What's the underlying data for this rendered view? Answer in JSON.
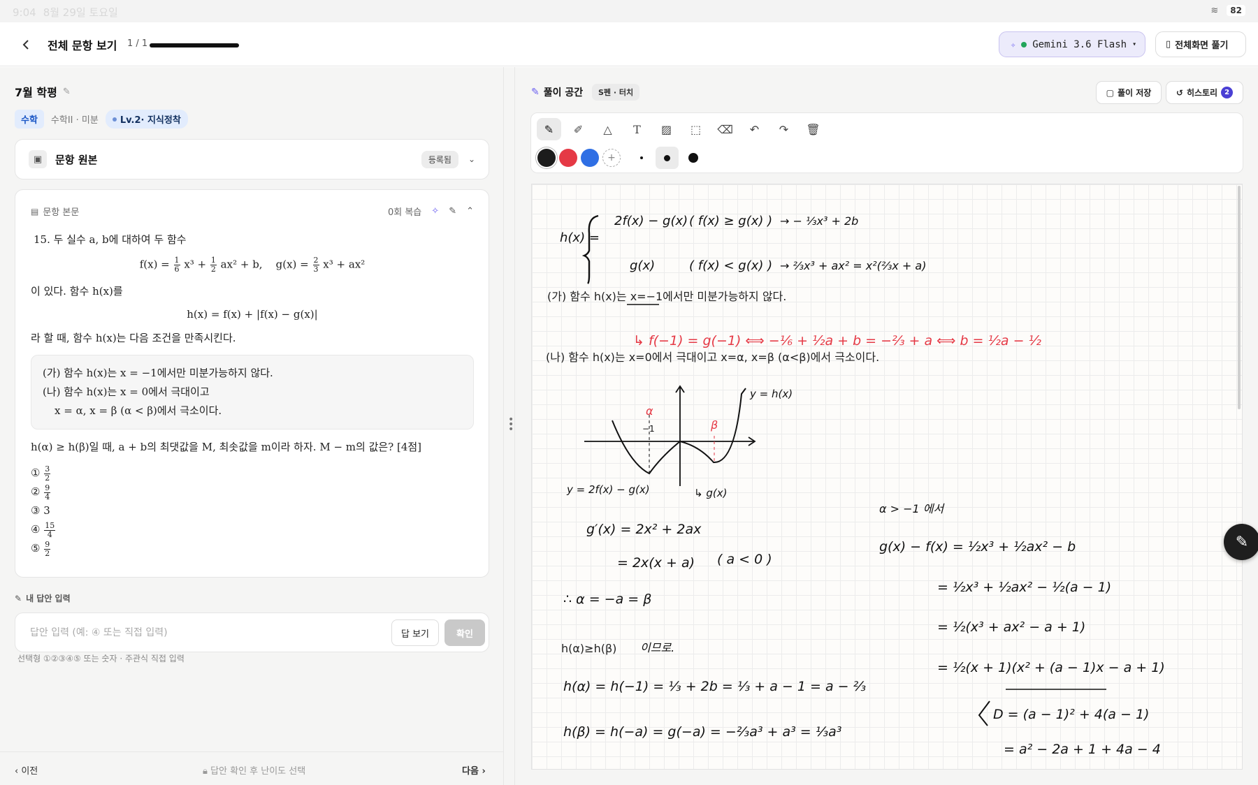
{
  "status_bar": {
    "time": "9:04",
    "date": "8월 29일 토요일",
    "battery": "82"
  },
  "topbar": {
    "title": "전체 문항 보기",
    "page_count": "1 / 1",
    "progress": 1.0,
    "model": "Gemini 3.6 Flash",
    "fullscreen_label": "전체화면 풀기"
  },
  "exam": {
    "title": "7월 학평",
    "tags": {
      "subject": "수학",
      "unit": "수학II · 미분",
      "level": "Lv.2· 지식정착"
    }
  },
  "original": {
    "title": "문항 원본",
    "badge": "등록됨"
  },
  "problem_card": {
    "header": "문항 본문",
    "review_count": "0회 복습",
    "intro": "15. 두 실수 a, b에 대하여 두 함수",
    "fx_label": "f(x) = ",
    "fx_mid1": "x³ + ",
    "fx_mid2": "ax² + b,",
    "gx_label": "g(x) = ",
    "gx_mid": "x³ + ax²",
    "frac_one": "1",
    "frac_six": "6",
    "frac_two": "2",
    "frac_three": "3",
    "line2": "이 있다. 함수 h(x)를",
    "hx": "h(x) = f(x) + |f(x) − g(x)|",
    "line3": "라 할 때, 함수 h(x)는 다음 조건을 만족시킨다.",
    "cond1": "(가) 함수 h(x)는 x = −1에서만 미분가능하지 않다.",
    "cond2": "(나) 함수 h(x)는 x = 0에서 극대이고",
    "cond3": "x = α, x = β (α < β)에서 극소이다.",
    "question": "h(α) ≥ h(β)일 때, a + b의 최댓값을 M, 최솟값을 m이라 하자. M − m의 값은? [4점]",
    "choices": [
      {
        "num": "①",
        "n": "3",
        "d": "2"
      },
      {
        "num": "②",
        "n": "9",
        "d": "4"
      },
      {
        "num": "③",
        "value": "3"
      },
      {
        "num": "④",
        "n": "15",
        "d": "4"
      },
      {
        "num": "⑤",
        "n": "9",
        "d": "2"
      }
    ]
  },
  "answer": {
    "label": "내 답안 입력",
    "placeholder": "답안 입력 (예: ④ 또는 직접 입력)",
    "show_label": "답 보기",
    "confirm_label": "확인",
    "hint": "선택형 ①②③④⑤ 또는 숫자 · 주관식 직접 입력"
  },
  "footer": {
    "prev": "이전",
    "middle": "답안 확인 후 난이도 선택",
    "next": "다음"
  },
  "workspace": {
    "title": "풀이 공간",
    "mode": "S펜 · 터치",
    "save_label": "풀이 저장",
    "history_label": "히스토리",
    "history_count": "2",
    "colors": [
      "#1c1c1c",
      "#e53945",
      "#2f6fe4"
    ],
    "typed_line1": "(가) 함수 h(x)는 x=−1에서만 미분가능하지 않다.",
    "typed_line2": "(나) 함수 h(x)는 x=0에서 극대이고 x=α, x=β (α<β)에서 극소이다.",
    "typed_line3": "h(α)≥h(β)",
    "hw": {
      "hx": "h(x) =",
      "case1": "2f(x) − g(x)",
      "case1_cond": "( f(x) ≥ g(x) )",
      "case1_res": "→  − ⅓x³ + 2b",
      "case2": "g(x)",
      "case2_cond": "( f(x) < g(x) )",
      "case2_res": "→  ⅔x³ + ax² = x²(⅔x + a)",
      "red1": "↳ f(−1) = g(−1)  ⟺  −⅙ + ½a + b = −⅔ + a  ⟺  b = ½a − ½",
      "graph_y": "y = h(x)",
      "graph_left": "y = 2f(x) − g(x)",
      "graph_right": "↳ g(x)",
      "alpha": "α",
      "beta": "β",
      "minus1": "−1",
      "gp1": "g′(x) =  2x² + 2ax",
      "gp2": "= 2x(x + a)",
      "gp_cond": "( a < 0 )",
      "ab": "∴  α = −a = β",
      "ige": "이므로.",
      "ha": "h(α) = h(−1) =  ⅓ + 2b = ⅓ + a − 1 = a − ⅔",
      "hb": "h(β) = h(−a) = g(−a) = −⅔a³ + a³ = ⅓a³",
      "case_note": "α > −1 에서",
      "r1": "g(x) − f(x) =  ½x³ + ½ax² − b",
      "r2": "= ½x³ + ½ax² − ½(a − 1)",
      "r3": "= ½(x³ + ax² − a + 1)",
      "r4": "= ½(x + 1)(x² + (a − 1)x − a + 1)",
      "r5": "D = (a − 1)² + 4(a − 1)",
      "r6": "= a² − 2a + 1 + 4a − 4"
    }
  }
}
